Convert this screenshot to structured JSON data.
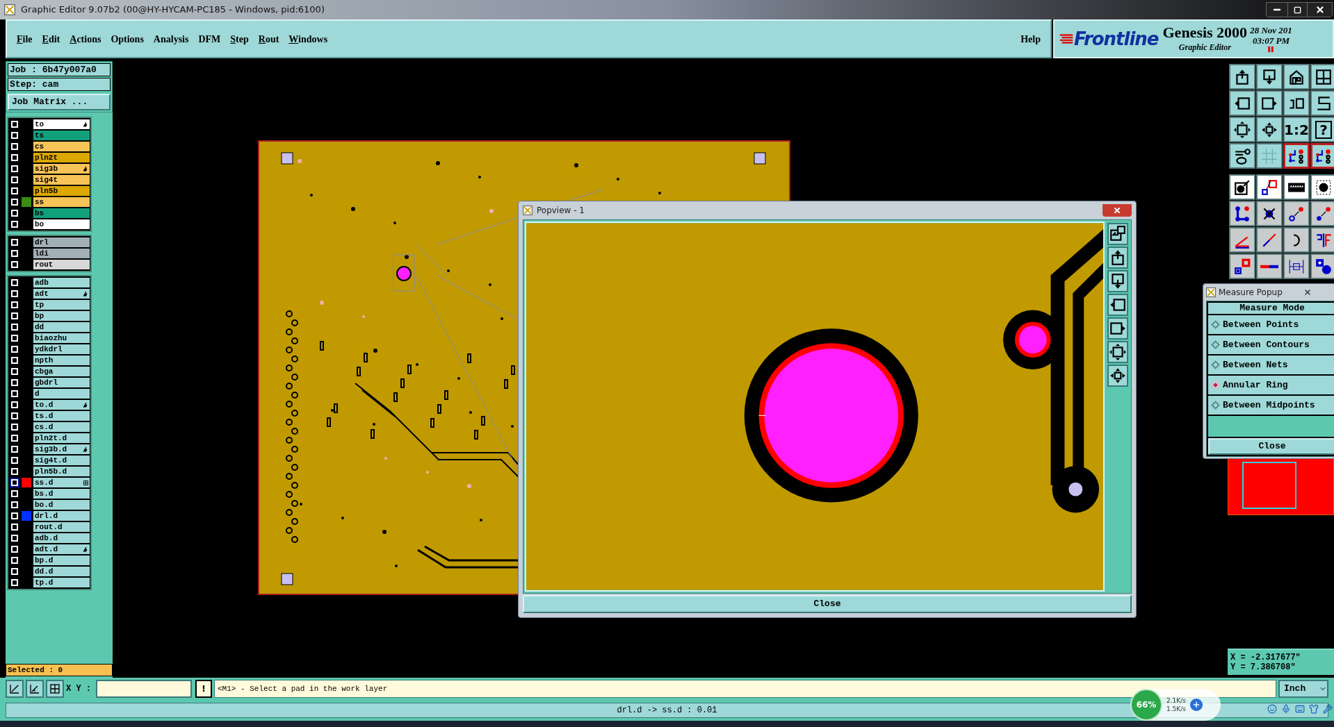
{
  "window": {
    "title": "Graphic Editor 9.07b2 (00@HY-HYCAM-PC185 - Windows, pid:6100)"
  },
  "menu": [
    {
      "label": "File",
      "mnemonic": true
    },
    {
      "label": "Edit",
      "mnemonic": true
    },
    {
      "label": "Actions",
      "mnemonic": true
    },
    {
      "label": "Options",
      "mnemonic": false
    },
    {
      "label": "Analysis",
      "mnemonic": false
    },
    {
      "label": "DFM",
      "mnemonic": false
    },
    {
      "label": "Step",
      "mnemonic": true
    },
    {
      "label": "Rout",
      "mnemonic": true
    },
    {
      "label": "Windows",
      "mnemonic": true
    }
  ],
  "help_menu": "Help",
  "logo": {
    "brand": "Frontline",
    "product": "Genesis 2000",
    "subtitle": "Graphic Editor",
    "date": "28 Nov 201",
    "time": "03:07 PM"
  },
  "job": {
    "job": "Job : 6b47y007a0",
    "step": "Step: cam",
    "matrix_button": "Job Matrix ..."
  },
  "layer_groups": [
    {
      "layers": [
        {
          "name": "to",
          "color": "#ffffff",
          "selected": false,
          "pointer": true
        },
        {
          "name": "ts",
          "color": "#12a07c",
          "selected": false
        },
        {
          "name": "cs",
          "color": "#f8c458",
          "selected": false
        },
        {
          "name": "pln2t",
          "color": "#dca800",
          "selected": false
        },
        {
          "name": "sig3b",
          "color": "#f8c458",
          "selected": false,
          "pointer": true
        },
        {
          "name": "sig4t",
          "color": "#f8c458",
          "selected": false
        },
        {
          "name": "pln5b",
          "color": "#dca800",
          "selected": false
        },
        {
          "name": "ss",
          "color": "#f8c458",
          "selected": false,
          "swatch": {
            "color": "#3a8c10"
          }
        },
        {
          "name": "bs",
          "color": "#12a07c",
          "selected": false
        },
        {
          "name": "bo",
          "color": "#ffffff",
          "selected": false
        }
      ]
    },
    {
      "layers": [
        {
          "name": "drl",
          "color": "#a2b0b6",
          "selected": false
        },
        {
          "name": "ldi",
          "color": "#a2b0b6",
          "selected": false
        },
        {
          "name": "rout",
          "color": "#d8d8d8",
          "selected": false
        }
      ]
    },
    {
      "layers": [
        {
          "name": "adb",
          "color": "#9ed8d8",
          "selected": false
        },
        {
          "name": "adt",
          "color": "#9ed8d8",
          "selected": false,
          "pointer": true
        },
        {
          "name": "tp",
          "color": "#9ed8d8",
          "selected": false
        },
        {
          "name": "bp",
          "color": "#9ed8d8",
          "selected": false
        },
        {
          "name": "dd",
          "color": "#9ed8d8",
          "selected": false
        },
        {
          "name": "biaozhu",
          "color": "#9ed8d8",
          "selected": false
        },
        {
          "name": "ydkdrl",
          "color": "#9ed8d8",
          "selected": false
        },
        {
          "name": "npth",
          "color": "#9ed8d8",
          "selected": false
        },
        {
          "name": "cbga",
          "color": "#9ed8d8",
          "selected": false
        },
        {
          "name": "gbdrl",
          "color": "#9ed8d8",
          "selected": false
        },
        {
          "name": "d",
          "color": "#9ed8d8",
          "selected": false
        },
        {
          "name": "to.d",
          "color": "#9ed8d8",
          "selected": false,
          "pointer": true
        },
        {
          "name": "ts.d",
          "color": "#9ed8d8",
          "selected": false
        },
        {
          "name": "cs.d",
          "color": "#9ed8d8",
          "selected": false
        },
        {
          "name": "pln2t.d",
          "color": "#9ed8d8",
          "selected": false
        },
        {
          "name": "sig3b.d",
          "color": "#9ed8d8",
          "selected": false,
          "pointer": true
        },
        {
          "name": "sig4t.d",
          "color": "#9ed8d8",
          "selected": false
        },
        {
          "name": "pln5b.d",
          "color": "#9ed8d8",
          "selected": false
        },
        {
          "name": "ss.d",
          "color": "#9ed8d8",
          "selected": true,
          "swatch": {
            "color": "#ff0000"
          },
          "grid": true
        },
        {
          "name": "bs.d",
          "color": "#9ed8d8",
          "selected": false
        },
        {
          "name": "bo.d",
          "color": "#9ed8d8",
          "selected": false
        },
        {
          "name": "drl.d",
          "color": "#9ed8d8",
          "selected": false,
          "swatch": {
            "color": "#0033ff"
          }
        },
        {
          "name": "rout.d",
          "color": "#9ed8d8",
          "selected": false
        },
        {
          "name": "adb.d",
          "color": "#9ed8d8",
          "selected": false
        },
        {
          "name": "adt.d",
          "color": "#9ed8d8",
          "selected": false,
          "pointer": true
        },
        {
          "name": "bp.d",
          "color": "#9ed8d8",
          "selected": false
        },
        {
          "name": "dd.d",
          "color": "#9ed8d8",
          "selected": false
        },
        {
          "name": "tp.d",
          "color": "#9ed8d8",
          "selected": false
        }
      ]
    }
  ],
  "selected_count": "Selected : 0",
  "popview": {
    "title": "Popview - 1",
    "close": "Close"
  },
  "measure_popup": {
    "title": "Measure Popup",
    "heading": "Measure Mode",
    "modes": [
      {
        "label": "Between Points",
        "selected": false
      },
      {
        "label": "Between Contours",
        "selected": false
      },
      {
        "label": "Between Nets",
        "selected": false
      },
      {
        "label": "Annular Ring",
        "selected": true
      },
      {
        "label": "Between Midpoints",
        "selected": false
      }
    ],
    "close": "Close"
  },
  "toolbar": {
    "ratio": "1:2",
    "help": "?"
  },
  "coordinates": {
    "x": "X = -2.317677\"",
    "y": "Y = 7.386708\""
  },
  "command_bar": {
    "xy_label": "X Y :",
    "alert_button": "!",
    "message": "<M1> - Select a pad in the work layer",
    "units": "Inch"
  },
  "status": "drl.d -> ss.d : 0.01",
  "tray": {
    "cpu": "66%",
    "upload": "2.1K/s",
    "download": "1.5K/s"
  }
}
